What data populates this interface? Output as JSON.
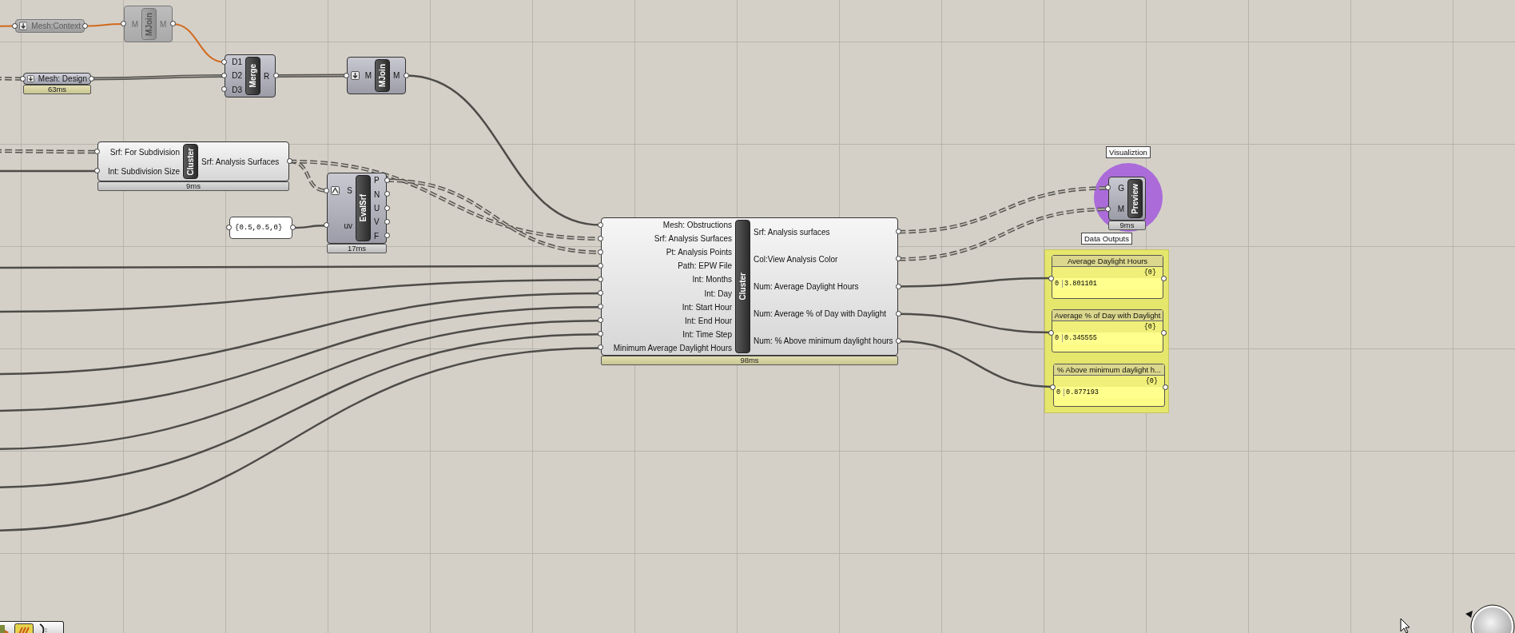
{
  "canvas": {
    "nodes": [
      {
        "kind": "param",
        "label": "Mesh:Context",
        "enabled": false
      },
      {
        "kind": "component",
        "name": "MJoin",
        "enabled": false,
        "inputs": [
          {
            "label": "M"
          }
        ],
        "outputs": [
          {
            "label": "M"
          }
        ]
      },
      {
        "kind": "param",
        "label": "Mesh: Design",
        "enabled": true,
        "timing": "63ms",
        "slow": true
      },
      {
        "kind": "component",
        "name": "Merge",
        "enabled": true,
        "inputs": [
          {
            "label": "D1"
          },
          {
            "label": "D2"
          },
          {
            "label": "D3"
          }
        ],
        "outputs": [
          {
            "label": "R"
          }
        ]
      },
      {
        "kind": "component",
        "name": "MJoin",
        "enabled": true,
        "inputs": [
          {
            "label": "M",
            "flatten": true
          }
        ],
        "outputs": [
          {
            "label": "M"
          }
        ]
      },
      {
        "kind": "cluster",
        "name": "Cluster",
        "enabled": true,
        "inputs": [
          {
            "label": "Srf: For Subdivision"
          },
          {
            "label": "Int: Subdivision Size"
          }
        ],
        "outputs": [
          {
            "label": "Srf: Analysis Surfaces"
          }
        ],
        "timing": "9ms",
        "slow": false
      },
      {
        "kind": "component",
        "name": "EvalSrf",
        "enabled": true,
        "inputs": [
          {
            "label": "S",
            "reparameterize": true
          },
          {
            "label": "uv"
          }
        ],
        "outputs": [
          {
            "label": "P"
          },
          {
            "label": "N"
          },
          {
            "label": "U"
          },
          {
            "label": "V"
          },
          {
            "label": "F"
          }
        ],
        "timing": "17ms",
        "slow": false
      },
      {
        "kind": "panel",
        "text": "{0.5,0.5,0}"
      },
      {
        "kind": "cluster",
        "name": "Cluster",
        "enabled": true,
        "inputs": [
          {
            "label": "Mesh: Obstructions"
          },
          {
            "label": "Srf: Analysis Surfaces"
          },
          {
            "label": "Pt: Analysis Points"
          },
          {
            "label": "Path: EPW File"
          },
          {
            "label": "Int: Months"
          },
          {
            "label": "Int: Day"
          },
          {
            "label": "Int: Start Hour"
          },
          {
            "label": "Int: End Hour"
          },
          {
            "label": "Int: Time Step"
          },
          {
            "label": "Minimum Average Daylight Hours"
          }
        ],
        "outputs": [
          {
            "label": "Srf: Analysis surfaces"
          },
          {
            "label": "Col:View Analysis Color"
          },
          {
            "label": "Num: Average Daylight Hours"
          },
          {
            "label": "Num: Average % of Day with Daylight"
          },
          {
            "label": "Num: % Above minimum daylight hours"
          }
        ],
        "timing": "98ms",
        "slow": true
      },
      {
        "kind": "component",
        "name": "Preview",
        "enabled": true,
        "inputs": [
          {
            "label": "G"
          },
          {
            "label": "M"
          }
        ],
        "timing": "9ms",
        "slow": false
      }
    ],
    "groups": [
      {
        "label": "Visualiztion",
        "kind": "circle",
        "color": "#ab6bd9"
      },
      {
        "label": "Data Outputs",
        "kind": "box",
        "color": "#e5e66c"
      }
    ],
    "data_panels": [
      {
        "title": "Average Daylight Hours",
        "path": "{0}",
        "index": "0",
        "value": "3.801101"
      },
      {
        "title": "Average % of Day with Daylight",
        "path": "{0}",
        "index": "0",
        "value": "0.345555"
      },
      {
        "title": "% Above minimum daylight h...",
        "path": "{0}",
        "index": "0",
        "value": "0.877193"
      }
    ]
  }
}
